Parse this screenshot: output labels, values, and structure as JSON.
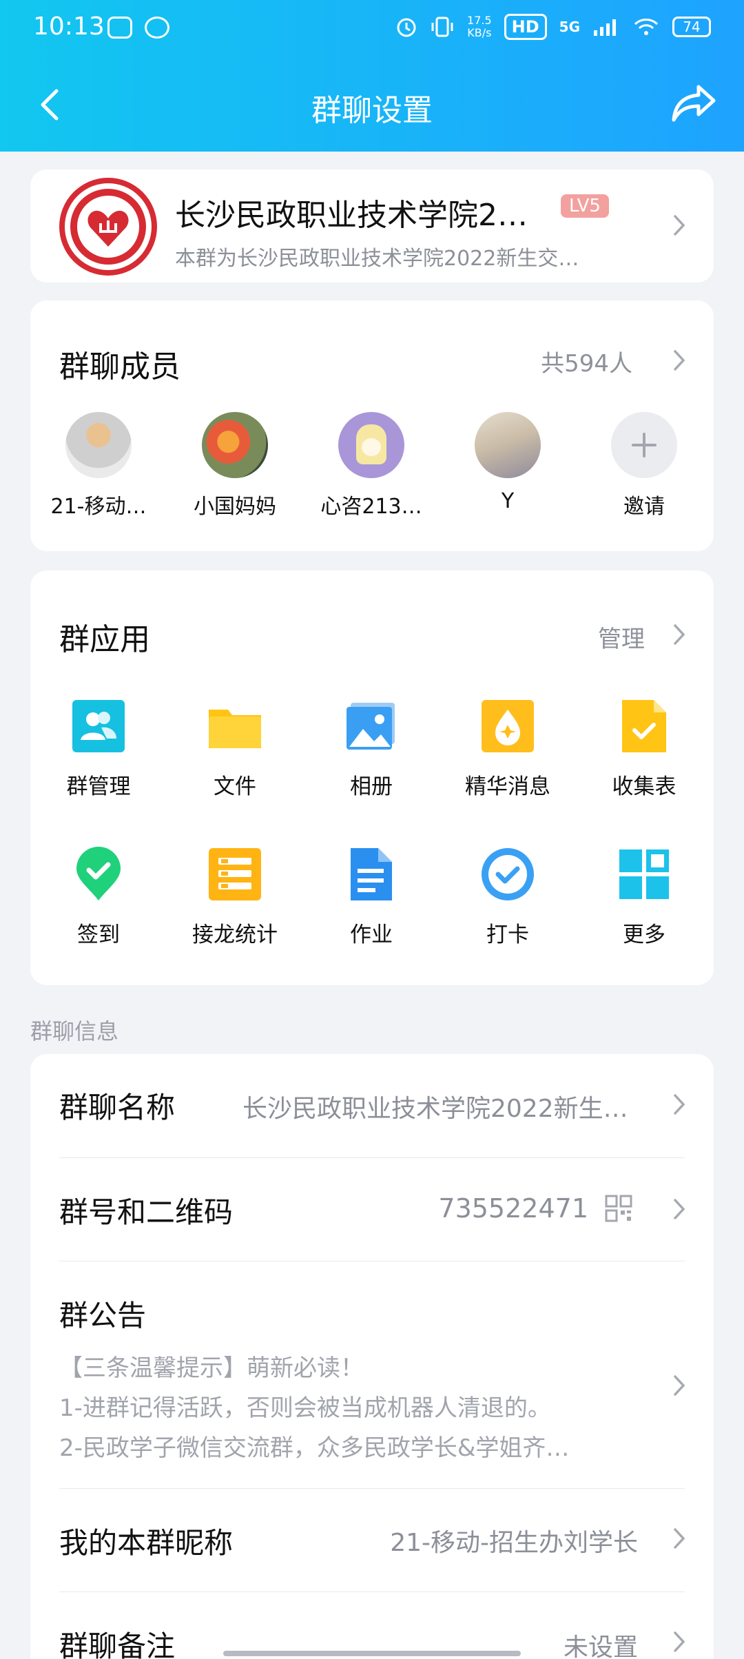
{
  "status_bar": {
    "time": "10:13",
    "network_speed": "17.5",
    "network_unit": "KB/s",
    "hd_label": "HD",
    "signal_label": "5G",
    "battery": "74"
  },
  "header": {
    "title": "群聊设置"
  },
  "group": {
    "name": "长沙民政职业技术学院2…",
    "level": "LV5",
    "description": "本群为长沙民政职业技术学院2022新生交…"
  },
  "members": {
    "title": "群聊成员",
    "count": "共594人",
    "list": [
      {
        "name": "21-移动…"
      },
      {
        "name": "小国妈妈"
      },
      {
        "name": "心咨213…"
      },
      {
        "name": "Y"
      },
      {
        "name": "邀请"
      }
    ]
  },
  "apps": {
    "title": "群应用",
    "manage_label": "管理",
    "items": [
      {
        "label": "群管理",
        "icon": "group-manage-icon"
      },
      {
        "label": "文件",
        "icon": "folder-icon"
      },
      {
        "label": "相册",
        "icon": "album-icon"
      },
      {
        "label": "精华消息",
        "icon": "essence-icon"
      },
      {
        "label": "收集表",
        "icon": "collect-form-icon"
      },
      {
        "label": "签到",
        "icon": "checkin-icon"
      },
      {
        "label": "接龙统计",
        "icon": "relay-stats-icon"
      },
      {
        "label": "作业",
        "icon": "homework-icon"
      },
      {
        "label": "打卡",
        "icon": "punch-icon"
      },
      {
        "label": "更多",
        "icon": "more-apps-icon"
      }
    ]
  },
  "info": {
    "caption": "群聊信息",
    "name_label": "群聊名称",
    "name_value": "长沙民政职业技术学院2022新生…",
    "number_label": "群号和二维码",
    "number_value": "735522471",
    "notice_label": "群公告",
    "notice_lines": [
      "【三条温馨提示】萌新必读！",
      "1-进群记得活跃，否则会被当成机器人清退的。",
      "2-民政学子微信交流群，众多民政学长&学姐齐…"
    ],
    "nickname_label": "我的本群昵称",
    "nickname_value": "21-移动-招生办刘学长",
    "remark_label": "群聊备注",
    "remark_value": "未设置"
  },
  "colors": {
    "header_start": "#12c7f0",
    "header_end": "#1ea3ff",
    "level_badge": "#f2a19f",
    "accent_red": "#d62b33"
  }
}
